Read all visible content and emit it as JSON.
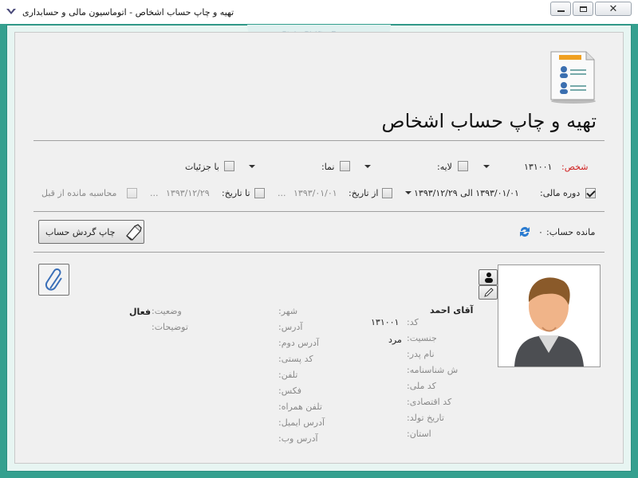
{
  "window": {
    "title": "تهیه و چاپ حساب اشخاص - اتوماسیون مالی و حسابداری",
    "watermark": "Ctrl+Shift+F",
    "accent": "#35a08f"
  },
  "header": {
    "title": "تهیه و چاپ حساب اشخاص"
  },
  "filters": {
    "person_label": "شخص:",
    "person_value": "۱۳۱۰۰۱",
    "layer_label": "لایه:",
    "view_label": "نما:",
    "details_label": "با جزئیات",
    "fiscal_label": "دوره مالی:",
    "fiscal_value": "۱۳۹۳/۰۱/۰۱ الی ۱۳۹۳/۱۲/۲۹",
    "from_label": "از تاریخ:",
    "from_value": "۱۳۹۳/۰۱/۰۱",
    "to_label": "تا تاریخ:",
    "to_value": "۱۳۹۳/۱۲/۲۹",
    "ellipsis": "...",
    "prev_balance_label": "محاسبه مانده از قبل"
  },
  "balance": {
    "label": "مانده حساب:",
    "value": "۰"
  },
  "print_button": {
    "label": "چاپ گردش حساب"
  },
  "person": {
    "name": "آقای احمد",
    "code_label": "کد:",
    "code_value": "۱۳۱۰۰۱",
    "gender_label": "جنسیت:",
    "gender_value": "مرد",
    "father_label": "نام پدر:",
    "id_label": "ش شناسنامه:",
    "national_label": "کد ملی:",
    "economic_label": "کد اقتصادی:",
    "birth_label": "تاریخ تولد:",
    "province_label": "استان:",
    "city_label": "شهر:",
    "address_label": "آدرس:",
    "address2_label": "آدرس دوم:",
    "postal_label": "کد پستی:",
    "phone_label": "تلفن:",
    "fax_label": "فکس:",
    "mobile_label": "تلفن همراه:",
    "email_label": "آدرس ایمیل:",
    "web_label": "آدرس وب:",
    "status_label": "وضعیت:",
    "status_value": "فعال",
    "notes_label": "توضیحات:"
  }
}
